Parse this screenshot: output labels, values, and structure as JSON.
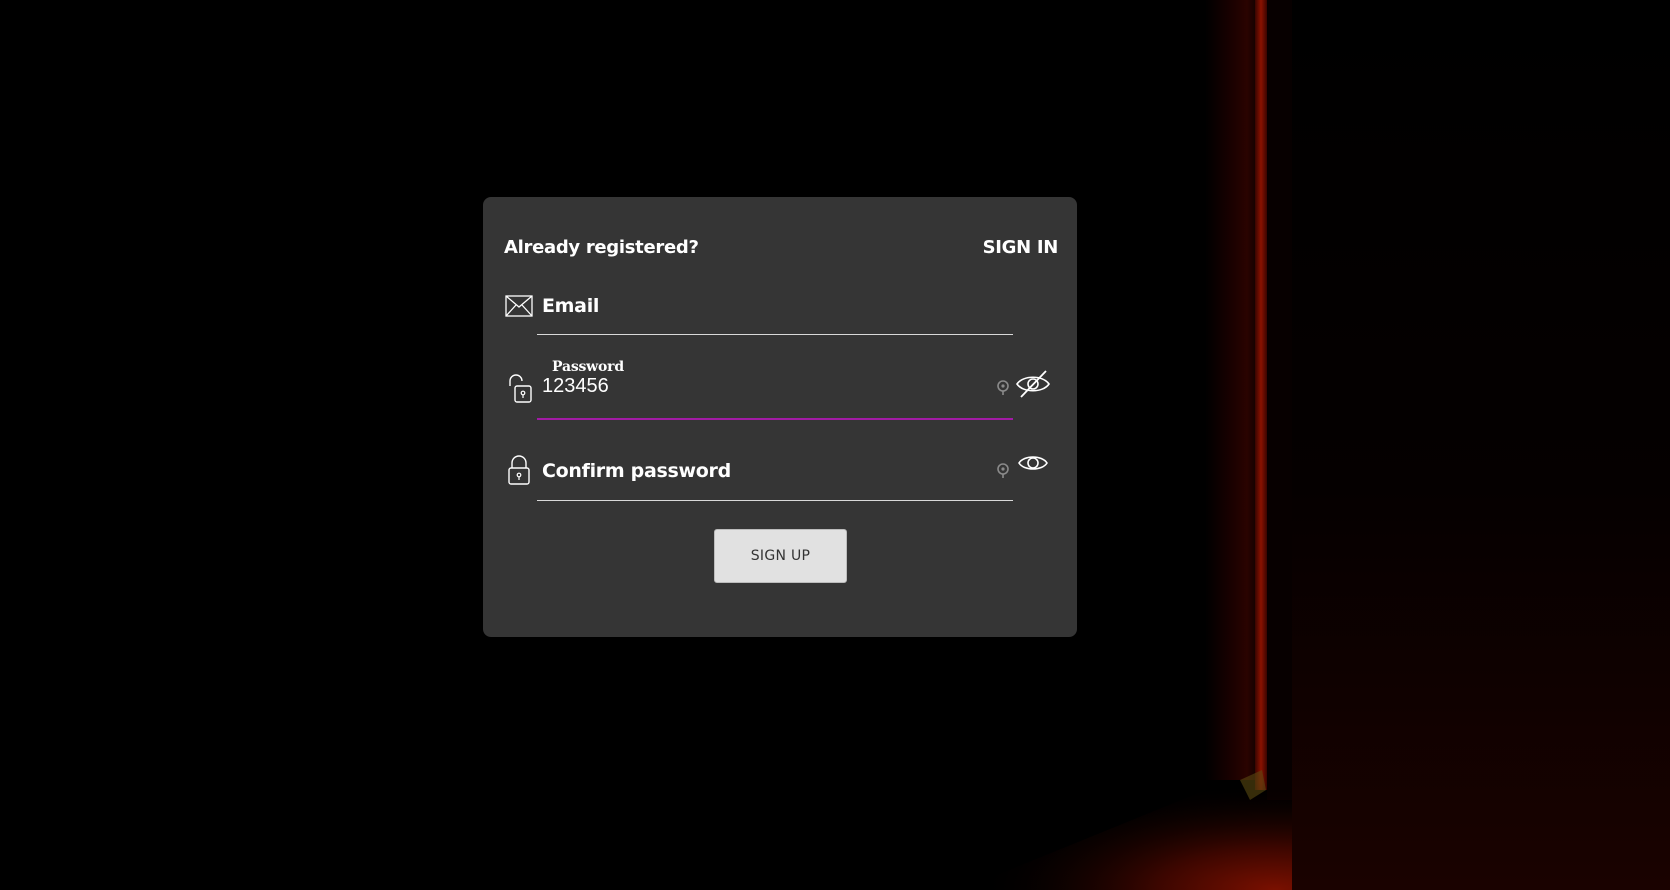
{
  "form": {
    "already_registered": "Already registered?",
    "sign_in_label": "SIGN IN",
    "email": {
      "placeholder": "Email",
      "value": ""
    },
    "password": {
      "label": "Password",
      "value": "123456",
      "visibility": "hidden-toggle"
    },
    "confirm_password": {
      "placeholder": "Confirm password",
      "value": ""
    },
    "sign_up_label": "SIGN UP"
  },
  "colors": {
    "page_background": "#000000",
    "card_background": "#353535",
    "focus_accent": "#a21ba5",
    "text": "#ffffff",
    "button_background": "#e1e1e1"
  },
  "icons": {
    "email": "envelope-icon",
    "password": "unlock-icon",
    "confirm_password": "lock-icon",
    "password_toggle": "eye-off-icon",
    "confirm_toggle": "eye-icon",
    "password_manager": "key-icon"
  }
}
